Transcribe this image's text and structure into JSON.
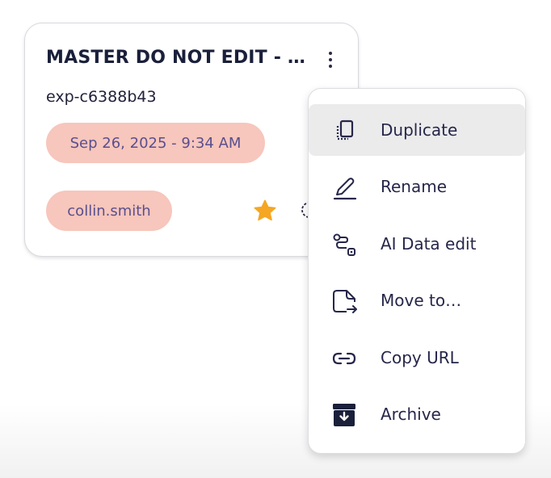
{
  "card": {
    "title": "MASTER DO NOT EDIT - …",
    "experiment_id": "exp-c6388b43",
    "date": "Sep 26, 2025 - 9:34 AM",
    "owner": "collin.smith",
    "favorite": true,
    "icons": {
      "menu": "more-vertical-icon",
      "favorite": "star-icon"
    }
  },
  "menu": {
    "items": [
      {
        "label": "Duplicate",
        "icon": "duplicate-icon",
        "highlighted": true
      },
      {
        "label": "Rename",
        "icon": "pencil-icon"
      },
      {
        "label": "AI Data edit",
        "icon": "route-icon"
      },
      {
        "label": "Move to…",
        "icon": "move-file-icon"
      },
      {
        "label": "Copy URL",
        "icon": "link-icon"
      },
      {
        "label": "Archive",
        "icon": "archive-icon"
      }
    ]
  },
  "colors": {
    "pill_bg": "#f7c6bc",
    "pill_text": "#5a4f8e",
    "star": "#f5a623",
    "menu_highlight": "#ebebec",
    "text": "#1a1f3a"
  }
}
